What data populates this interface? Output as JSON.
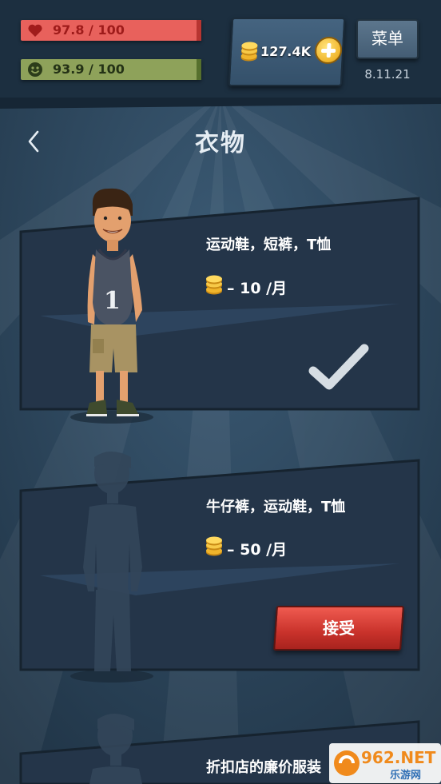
{
  "hud": {
    "health": {
      "icon": "heart-icon",
      "text": "97.8 / 100",
      "value": 97.8,
      "max": 100,
      "color": "#e8615c"
    },
    "happiness": {
      "icon": "smiley-icon",
      "text": "93.9 / 100",
      "value": 93.9,
      "max": 100,
      "color": "#8ea25a"
    },
    "coins": {
      "icon": "coin-stack-icon",
      "text": "127.4K"
    },
    "add_coins_icon": "plus-icon",
    "menu_label": "菜单",
    "version": "8.11.21"
  },
  "header": {
    "back_icon": "chevron-left-icon",
    "title": "衣物"
  },
  "options": [
    {
      "label": "运动鞋，短裤，T恤",
      "price": "– 10 /月",
      "status": "selected",
      "status_icon": "check-icon",
      "character": "unlocked"
    },
    {
      "label": "牛仔裤，运动鞋，T恤",
      "price": "– 50 /月",
      "status": "available",
      "action_label": "接受",
      "character": "silhouette"
    },
    {
      "label": "折扣店的廉价服装",
      "character": "silhouette"
    }
  ],
  "watermark": {
    "brand": "962.NET",
    "subtitle": "乐游网"
  },
  "colors": {
    "background": "#2b4459",
    "card": "#243549",
    "accept": "#d9453c",
    "gold": "#f0b52c"
  }
}
